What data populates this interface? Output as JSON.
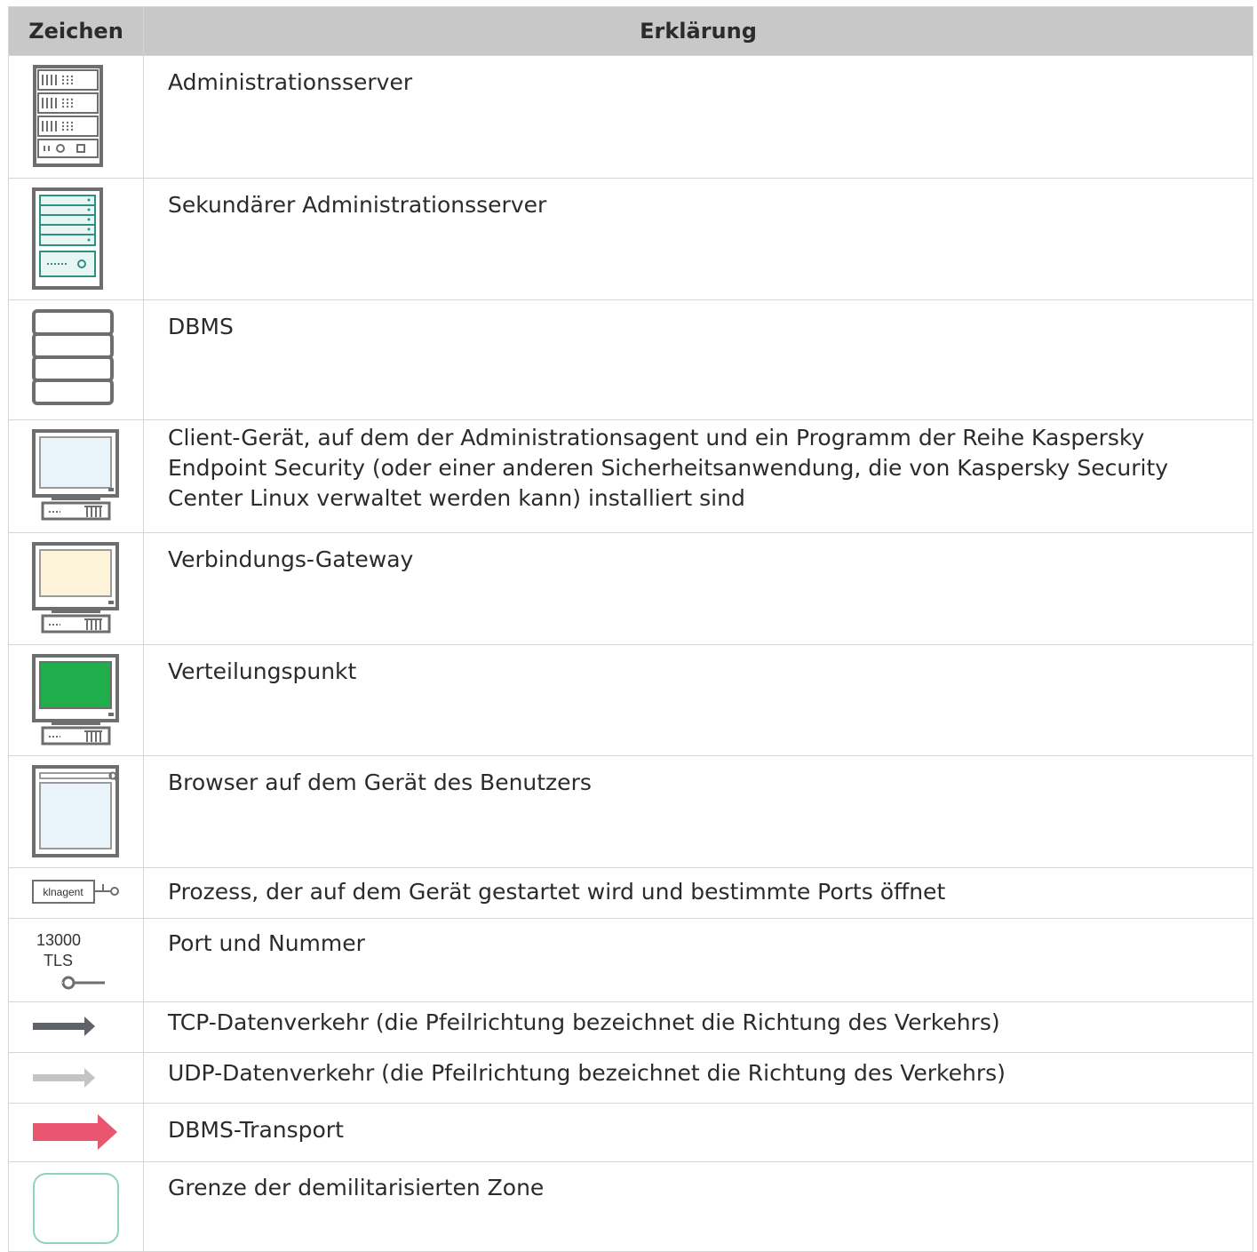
{
  "header": {
    "symbol": "Zeichen",
    "explanation": "Erklärung"
  },
  "rows": [
    {
      "icon": "administration-server-icon",
      "text": "Administrationsserver"
    },
    {
      "icon": "secondary-administration-server-icon",
      "text": "Sekundärer Administrationsserver"
    },
    {
      "icon": "dbms-icon",
      "text": "DBMS"
    },
    {
      "icon": "client-device-icon",
      "text": "Client-Gerät, auf dem der Administrationsagent und ein Programm der Reihe Kaspersky Endpoint Security (oder einer anderen Sicherheitsanwendung, die von Kaspersky Security Center Linux verwaltet werden kann) installiert sind"
    },
    {
      "icon": "connection-gateway-icon",
      "text": "Verbindungs-Gateway"
    },
    {
      "icon": "distribution-point-icon",
      "text": "Verteilungspunkt"
    },
    {
      "icon": "browser-icon",
      "text": "Browser auf dem Gerät des Benutzers"
    },
    {
      "icon": "process-icon",
      "label": "klnagent",
      "text": "Prozess, der auf dem Gerät gestartet wird und bestimmte Ports öffnet"
    },
    {
      "icon": "port-icon",
      "port_number": "13000",
      "port_protocol": "TLS",
      "text": "Port und Nummer"
    },
    {
      "icon": "tcp-arrow-icon",
      "text": "TCP-Datenverkehr (die Pfeilrichtung bezeichnet die Richtung des Verkehrs)"
    },
    {
      "icon": "udp-arrow-icon",
      "text": "UDP-Datenverkehr (die Pfeilrichtung bezeichnet die Richtung des Verkehrs)"
    },
    {
      "icon": "dbms-transport-arrow-icon",
      "text": "DBMS-Transport"
    },
    {
      "icon": "dmz-boundary-icon",
      "text": "Grenze der demilitarisierten Zone"
    }
  ],
  "colors": {
    "header_bg": "#c8c8c8",
    "icon_gray": "#6e6e6e",
    "client_screen": "#e9f4fb",
    "gateway_screen": "#fdf3d8",
    "distribution_screen": "#1fae4b",
    "tcp_arrow": "#5f6368",
    "udp_arrow": "#c4c4c4",
    "dbms_arrow": "#e8566f",
    "dmz_border": "#8fd1c3"
  }
}
